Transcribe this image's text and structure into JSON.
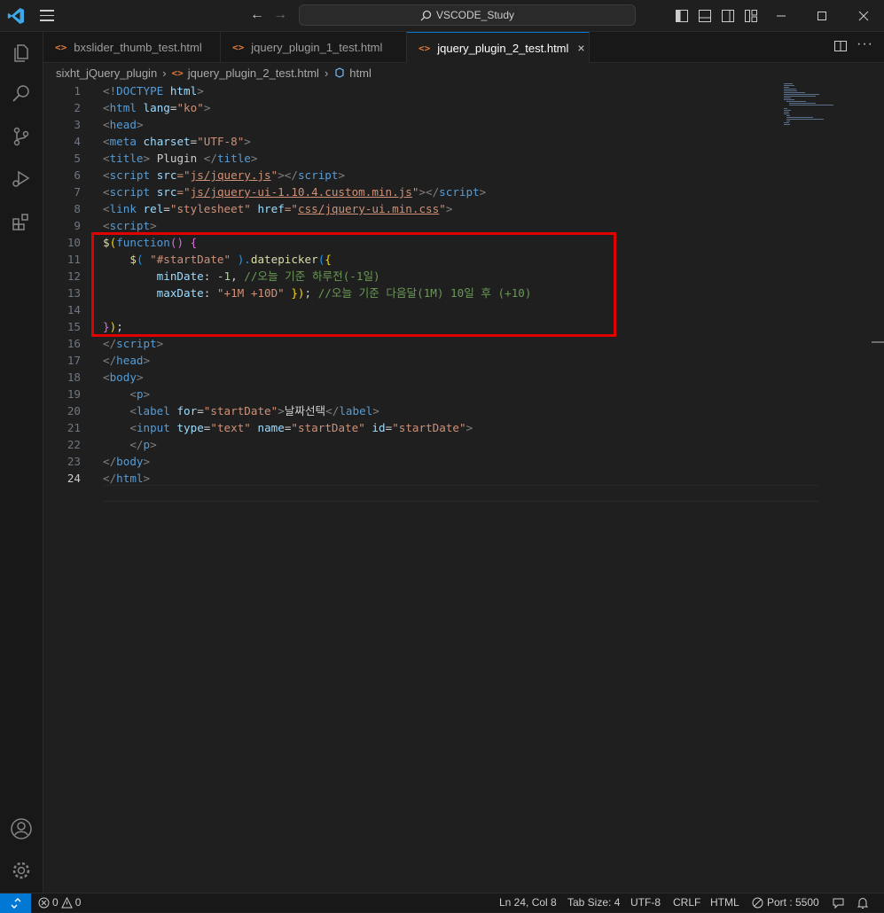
{
  "titlebar": {
    "search_text": "VSCODE_Study"
  },
  "tabs": [
    {
      "label": "bxslider_thumb_test.html",
      "active": false
    },
    {
      "label": "jquery_plugin_1_test.html",
      "active": false
    },
    {
      "label": "jquery_plugin_2_test.html",
      "active": true
    }
  ],
  "tab_icon_text": "<>",
  "tab_close_glyph": "×",
  "breadcrumb": {
    "folder": "sixht_jQuery_plugin",
    "file": "jquery_plugin_2_test.html",
    "symbol": "html"
  },
  "editor": {
    "line_numbers": [
      "1",
      "2",
      "3",
      "4",
      "5",
      "6",
      "7",
      "8",
      "9",
      "10",
      "11",
      "12",
      "13",
      "14",
      "15",
      "16",
      "17",
      "18",
      "19",
      "20",
      "21",
      "22",
      "23",
      "24"
    ],
    "current_line": "24"
  },
  "code": {
    "l1": {
      "a": "<!",
      "b": "DOCTYPE",
      "c": "html",
      "d": ">"
    },
    "l2": {
      "a": "<",
      "b": "html",
      "c": "lang",
      "d": "=",
      "e": "\"ko\"",
      "f": ">"
    },
    "l3": {
      "a": "<",
      "b": "head",
      "c": ">"
    },
    "l4": {
      "a": "<",
      "b": "meta",
      "c": "charset",
      "d": "=",
      "e": "\"UTF-8\"",
      "f": ">"
    },
    "l5": {
      "a": "<",
      "b": "title",
      "c": ">",
      "d": " Plugin ",
      "e": "</",
      "f": "title",
      "g": ">"
    },
    "l6": {
      "a": "<",
      "b": "script",
      "c": "src",
      "d": "=\"",
      "e": "js/jquery.js",
      "f": "\"",
      "g": "></",
      "h": "script",
      "i": ">"
    },
    "l7": {
      "a": "<",
      "b": "script",
      "c": "src",
      "d": "=\"",
      "e": "js/jquery-ui-1.10.4.custom.min.js",
      "f": "\"",
      "g": "></",
      "h": "script",
      "i": ">"
    },
    "l8": {
      "a": "<",
      "b": "link",
      "c": "rel",
      "d": "=",
      "e": "\"stylesheet\"",
      "f": "href",
      "g": "=\"",
      "h": "css/jquery-ui.min.css",
      "i": "\"",
      "j": ">"
    },
    "l9": {
      "a": "<",
      "b": "script",
      "c": ">"
    },
    "l10": {
      "a": "$",
      "b": "(",
      "c": "function",
      "d": "() {"
    },
    "l11": {
      "a": "    ",
      "b": "$",
      "c": "( ",
      "d": "\"#startDate\"",
      "e": " ).",
      "f": "datepicker",
      "g": "(",
      "h": "{"
    },
    "l12": {
      "a": "        ",
      "b": "minDate",
      "c": ": ",
      "d": "-1",
      "e": ", ",
      "f": "//오늘 기준 하루전(-1일)"
    },
    "l13": {
      "a": "        ",
      "b": "maxDate",
      "c": ": ",
      "d": "\"+1M +10D\"",
      "e": " ",
      "f": "})",
      "g": "; ",
      "h": "//오늘 기준 다음달(1M) 10일 후 (+10)"
    },
    "l14": {
      "a": ""
    },
    "l15": {
      "a": "}",
      "b": ")",
      "c": ";"
    },
    "l16": {
      "a": "</",
      "b": "script",
      "c": ">"
    },
    "l17": {
      "a": "</",
      "b": "head",
      "c": ">"
    },
    "l18": {
      "a": "<",
      "b": "body",
      "c": ">"
    },
    "l19": {
      "a": "    ",
      "b": "<",
      "c": "p",
      "d": ">"
    },
    "l20": {
      "a": "    ",
      "b": "<",
      "c": "label",
      "d": "for",
      "e": "=",
      "f": "\"startDate\"",
      "g": ">",
      "h": "날짜선택",
      "i": "</",
      "j": "label",
      "k": ">"
    },
    "l21": {
      "a": "    ",
      "b": "<",
      "c": "input",
      "d": "type",
      "e": "=",
      "f": "\"text\"",
      "g": "name",
      "h": "=",
      "i": "\"startDate\"",
      "j": "id",
      "k": "=",
      "l": "\"startDate\"",
      "m": ">"
    },
    "l22": {
      "a": "    ",
      "b": "</",
      "c": "p",
      "d": ">"
    },
    "l23": {
      "a": "</",
      "b": "body",
      "c": ">"
    },
    "l24": {
      "a": "</",
      "b": "html",
      "c": ">"
    }
  },
  "statusbar": {
    "errors": "0",
    "warnings": "0",
    "position": "Ln 24, Col 8",
    "tab_size": "Tab Size: 4",
    "encoding": "UTF-8",
    "eol": "CRLF",
    "language": "HTML",
    "port": "Port : 5500"
  },
  "colors": {
    "accent": "#0078d4",
    "highlight_box": "#e00000"
  }
}
